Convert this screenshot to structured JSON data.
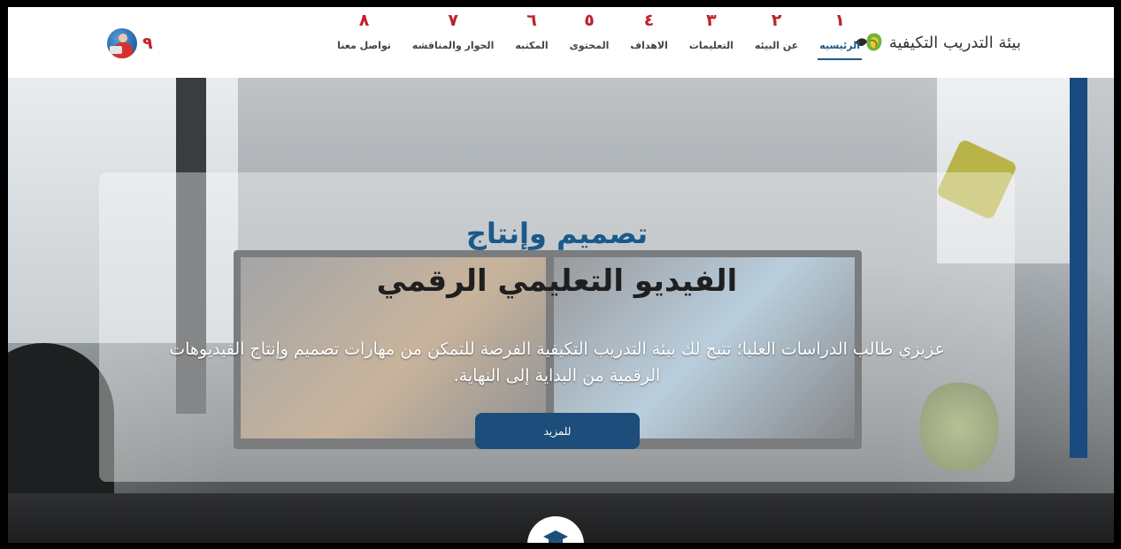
{
  "brand": {
    "name": "بيئة التدريب التكيفية"
  },
  "nav": {
    "items": [
      {
        "num": "١",
        "label": "الرئيسيه",
        "active": true
      },
      {
        "num": "٢",
        "label": "عن البيئه",
        "active": false
      },
      {
        "num": "٣",
        "label": "التعليمات",
        "active": false
      },
      {
        "num": "٤",
        "label": "الاهداف",
        "active": false
      },
      {
        "num": "٥",
        "label": "المحتوى",
        "active": false
      },
      {
        "num": "٦",
        "label": "المكتبه",
        "active": false
      },
      {
        "num": "٧",
        "label": "الحوار والمناقشه",
        "active": false
      },
      {
        "num": "٨",
        "label": "تواصل معنا",
        "active": false
      }
    ],
    "avatar_num": "٩"
  },
  "hero": {
    "title_line1": "تصميم وإنتاج",
    "title_line2": "الفيديو التعليمي الرقمي",
    "description": "عزيزي طالب الدراسات العليا؛ تتيح لك بيئة التدريب التكيفية الفرصة للتمكن من مهارات تصميم وإنتاج الفيديوهات الرقمية من البداية إلى النهاية.",
    "button_label": "للمزيد"
  },
  "colors": {
    "accent": "#1a5a8a",
    "button": "#1d4d7a",
    "number_red": "#c0222b"
  },
  "icons": {
    "scroll": "graduation-cap-icon",
    "brand": "leaf-logo-icon"
  }
}
